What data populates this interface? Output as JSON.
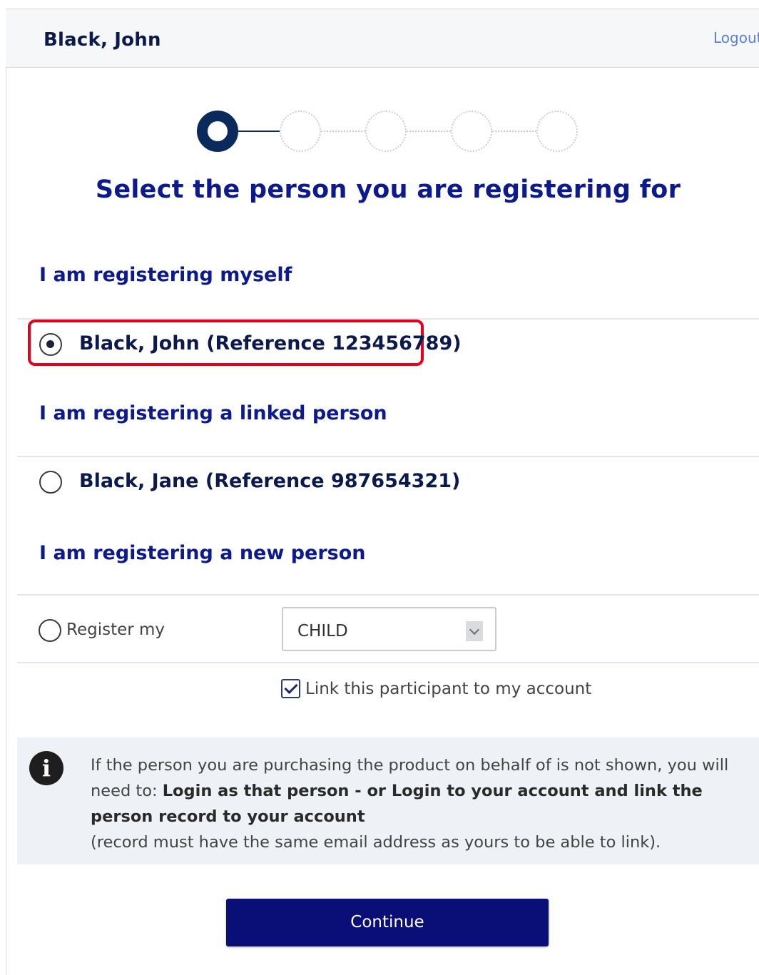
{
  "header": {
    "user_name": "Black, John",
    "logout_label": "Logout"
  },
  "stepper": {
    "total_steps": 5,
    "current_step": 1
  },
  "page": {
    "title": "Select the person you are registering for"
  },
  "sections": {
    "myself": {
      "title": "I am registering myself",
      "option_label": "Black, John (Reference 123456789)",
      "selected": true
    },
    "linked": {
      "title": "I am registering a linked person",
      "option_label": "Black, Jane (Reference 987654321)",
      "selected": false
    },
    "new_person": {
      "title": "I am registering a new person",
      "register_label": "Register my",
      "select_value": "CHILD",
      "link_checkbox_label": "Link this participant to my account",
      "link_checked": true
    }
  },
  "info": {
    "text_1": "If the person you are purchasing the product on behalf of is not shown, you will need to: ",
    "text_bold": "Login as that person - or Login to your account and link the person record to your account",
    "text_2": "(record must have the same email address as yours to be able to link)."
  },
  "continue_label": "Continue",
  "colors": {
    "accent": "#0d1a8c",
    "button": "#0a0f78",
    "highlight": "#e4001b",
    "info_bg": "#eef1f5"
  }
}
